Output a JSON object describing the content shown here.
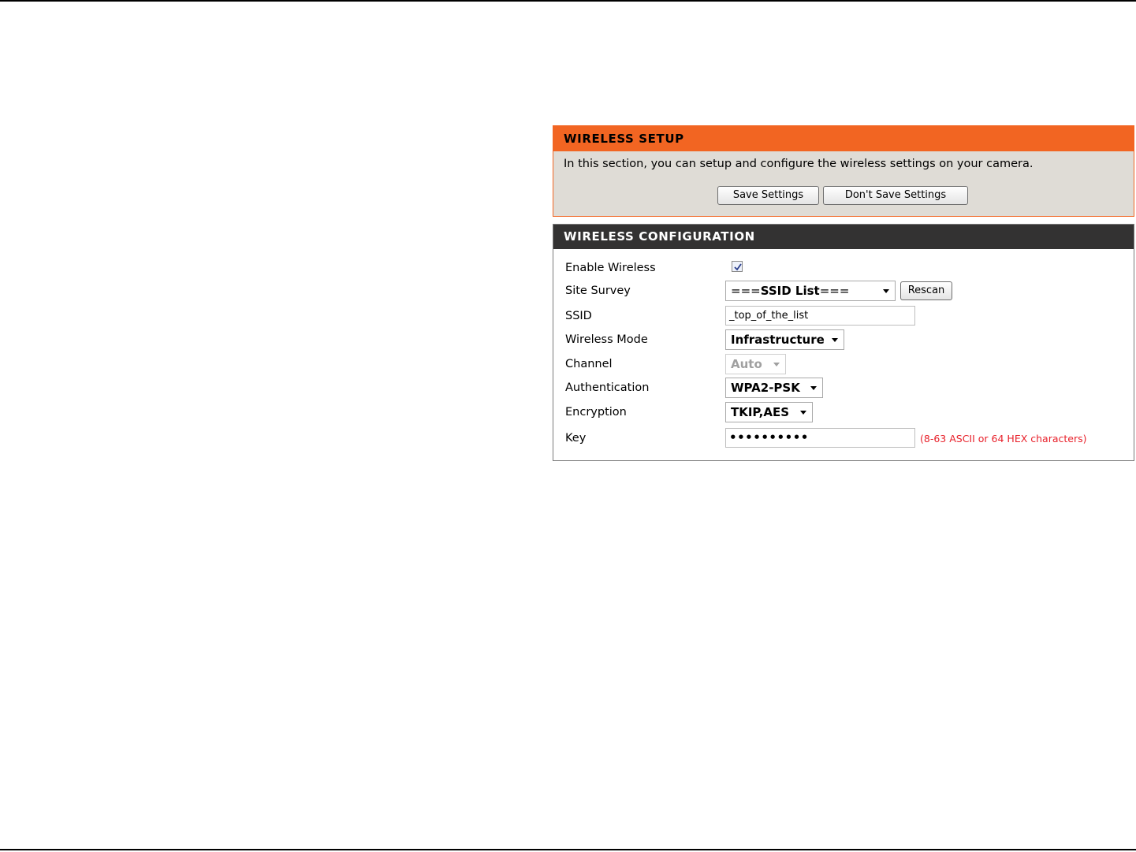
{
  "setup": {
    "title": "WIRELESS SETUP",
    "description": "In this section, you can setup and configure the wireless settings on your camera.",
    "save_label": "Save Settings",
    "dont_save_label": "Don't Save Settings",
    "header_color": "#f26522"
  },
  "config": {
    "title": "WIRELESS CONFIGURATION",
    "header_color": "#333232",
    "enable_wireless": {
      "label": "Enable Wireless",
      "checked": true
    },
    "site_survey": {
      "label": "Site Survey",
      "prefix": "===",
      "selected": "SSID List",
      "suffix": "===",
      "rescan_label": "Rescan"
    },
    "ssid": {
      "label": "SSID",
      "value": "_top_of_the_list"
    },
    "wireless_mode": {
      "label": "Wireless Mode",
      "selected": "Infrastructure"
    },
    "channel": {
      "label": "Channel",
      "selected": "Auto",
      "disabled": true
    },
    "authentication": {
      "label": "Authentication",
      "selected": "WPA2-PSK"
    },
    "encryption": {
      "label": "Encryption",
      "selected": "TKIP,AES"
    },
    "key": {
      "label": "Key",
      "masked_value": "••••••••••",
      "hint": "(8-63 ASCII or 64 HEX characters)",
      "hint_color": "#e8202a"
    }
  }
}
